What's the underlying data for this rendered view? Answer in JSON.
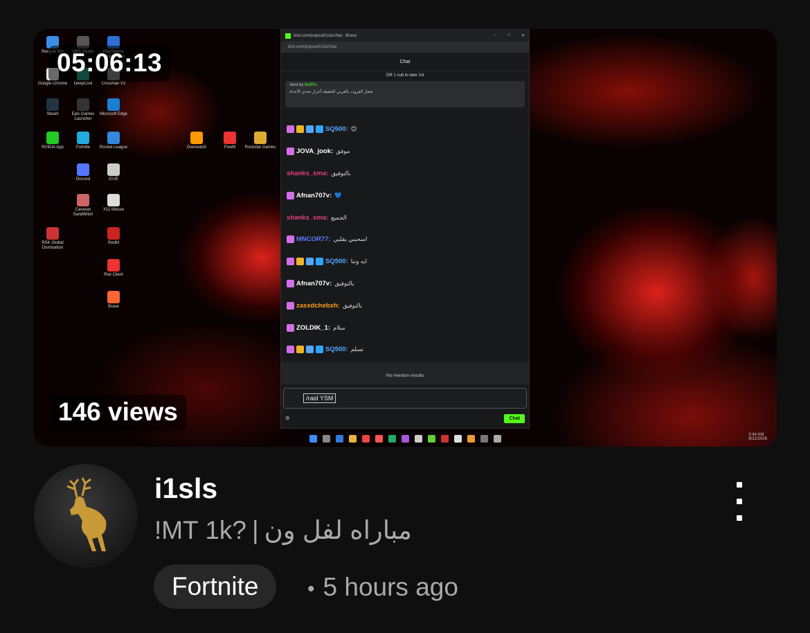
{
  "video": {
    "duration": "05:06:13",
    "views": "146 views",
    "channel": "i1sls",
    "title_part1": "!MT 1k?",
    "title_separator": "|",
    "title_part2": "مباراه لفل ون",
    "game_chip": "Fortnite",
    "time_ago": "5 hours ago",
    "more_icon": "vertical-ellipsis-icon"
  },
  "stream_window": {
    "window_title": "kick.com/popout/i1sls/chat - Brave",
    "url": "kick.com/popout/i1sls/chat",
    "chat_header": "Chat",
    "gift_banner": "Gift 1 sub to take 1st",
    "pinned_sender": "Sent by",
    "pinned_sender_name": "BotRix",
    "pinned_text": "شعار القروب بالعربي الحقيقة أحرار تحدي الأعداء",
    "messages": [
      {
        "user": "SQ500",
        "text": "😊",
        "color": "#53a7ff"
      },
      {
        "user": "JOVA_jook",
        "text": "موفق",
        "color": "#ffffff"
      },
      {
        "user": "shanks_sma",
        "text": "بالتوفيق",
        "color": "#e0407a"
      },
      {
        "user": "Afnan707v",
        "text": "💙",
        "color": "#ffffff"
      },
      {
        "user": "shanks_sma",
        "text": "الجميع",
        "color": "#e0407a"
      },
      {
        "user": "MNCOR77",
        "text": "اسحبني يقلبي",
        "color": "#5c7cff"
      },
      {
        "user": "SQ500",
        "text": "ايه وننا",
        "color": "#53a7ff"
      },
      {
        "user": "Afnan707v",
        "text": "بالتوفيق",
        "color": "#ffffff"
      },
      {
        "user": "zasxdchebxh",
        "text": "بالتوفيق",
        "color": "#ff9f1a"
      },
      {
        "user": "ZOLDIK_1",
        "text": "سلام",
        "color": "#ffffff"
      },
      {
        "user": "SQ500",
        "text": "تسلم",
        "color": "#53a7ff"
      }
    ],
    "mention_results": "No mention results",
    "chat_input_value": "/raid YSM",
    "send_button": "Chat",
    "desktop_icons": [
      "Recycle Bin",
      "OBS Studio",
      "PlayStation Accessories",
      "Google Chrome",
      "DeepCool",
      "Crosshair V2",
      "Steam",
      "Epic Games Launcher",
      "Microsoft Edge",
      "NVIDIA App",
      "Fortnite",
      "Rocket League",
      "Overwatch",
      "FiveM",
      "Rockstar Games",
      "Discord",
      "iCUE",
      "Caravan SandWitch",
      "X11 Mouse",
      "RSK Global Domination",
      "RedM",
      "Riot Client",
      "Brave"
    ],
    "tray_time": "3:44 AM",
    "tray_date": "8/22/2026"
  }
}
